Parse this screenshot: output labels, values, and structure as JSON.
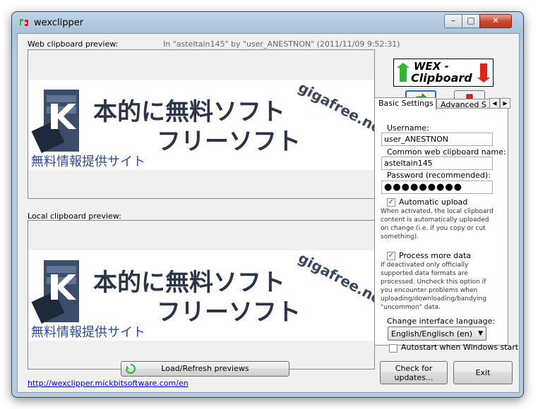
{
  "window": {
    "title": "wexclipper",
    "controls": {
      "minimize": "–",
      "maximize": "□",
      "close": "✕"
    }
  },
  "web_preview": {
    "label": "Web clipboard preview:",
    "meta": "In \"asteltain145\" by \"user_ANESTNON\" (2011/11/09 9:52:31)"
  },
  "local_preview": {
    "label": "Local clipboard preview:"
  },
  "preview_image": {
    "line1": "本的に無料ソフト",
    "line2": "フリーソフト",
    "line3": "無料情報提供サイト",
    "side": "gigafree.net"
  },
  "logo": {
    "line1": "WEX -",
    "line2": "Clipboard"
  },
  "tabs": {
    "basic": "Basic Settings",
    "advanced": "Advanced S"
  },
  "settings": {
    "username_label": "Username:",
    "username_value": "user_ANESTNON",
    "clipboard_label": "Common web clipboard name:",
    "clipboard_value": "asteltain145",
    "password_label": "Password (recommended):",
    "password_value": "●●●●●●●●●",
    "auto_upload_label": "Automatic upload",
    "auto_upload_desc": "When activated, the local clipboard content is automatically uploaded on change (i.e. if you copy or cut something).",
    "process_more_label": "Process more data",
    "process_more_desc": "If deactivated only officially supported data formats are processed. Uncheck this option if you encounter problems when uploading/downloading/bandying \"uncommon\" data.",
    "language_label": "Change interface language:",
    "language_value": "English/Englisch (en)",
    "autostart_label": "Autostart when Windows start"
  },
  "buttons": {
    "load_refresh": "Load/Refresh previews",
    "check_updates_l1": "Check for",
    "check_updates_l2": "updates...",
    "exit": "Exit"
  },
  "link": "http://wexclipper.mickbitsoftware.com/en",
  "colors": {
    "accent_green": "#2fb52f",
    "accent_red": "#e0241c",
    "link": "#0000ee"
  }
}
